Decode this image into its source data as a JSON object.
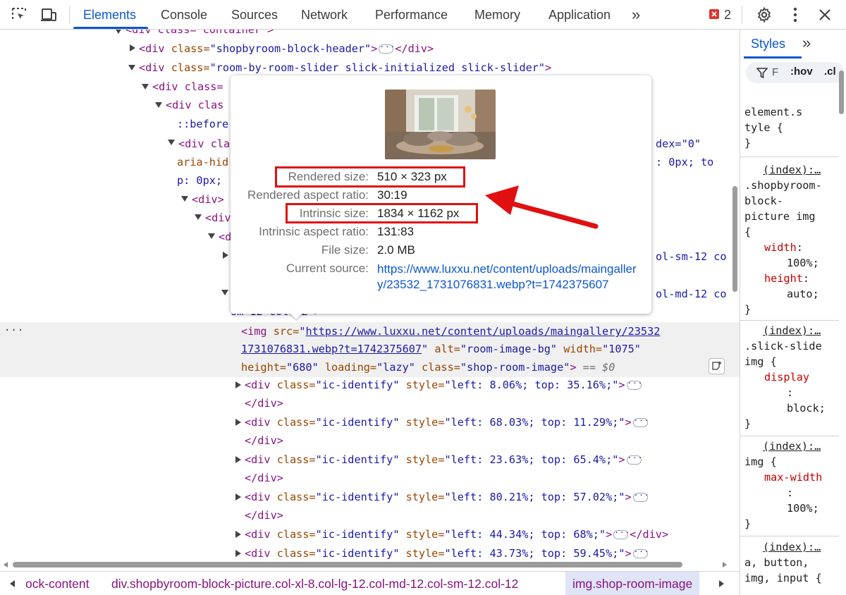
{
  "toolbar": {
    "tabs": [
      "Elements",
      "Console",
      "Sources",
      "Network",
      "Performance",
      "Memory",
      "Application"
    ],
    "active_tab": "Elements",
    "more_tabs": "»",
    "error_count": "2",
    "icons": [
      "inspect-element-icon",
      "device-toolbar-icon",
      "more-tabs-icon",
      "error-icon",
      "settings-gear-icon",
      "kebab-menu-icon",
      "close-icon"
    ]
  },
  "dom": {
    "line0": "<div class=\"container\">",
    "l1_tag_open": "<div ",
    "l1_attr": "class=",
    "l1_val": "\"shopbyroom-block-header\"",
    "l1_close": ">",
    "l1_end": "</div>",
    "l2_tag_open": "<div ",
    "l2_attr": "class=",
    "l2_val": "\"room-by-room-slider slick-initialized slick-slider\"",
    "l2_close": ">",
    "l3": "<div class=",
    "l4": "<div clas",
    "l5": "::before",
    "l6": "<div cla",
    "l6_right": "dex=\"0\"",
    "l7": "aria-hid",
    "l7_right": ": 0px; to",
    "l8": "p: 0px;",
    "l9": "<div>",
    "l10": "<div",
    "l11": "<d",
    "l12_right": "ol-sm-12 co",
    "l13_right": "ol-md-12 co",
    "l14": "sm-12 col-12\">",
    "img_open": "<img ",
    "img_src_attr": "src=",
    "img_src_q1": "\"",
    "img_src_url1": "https://www.luxxu.net/content/uploads/maingallery/23532",
    "img_src_url2": "1731076831.webp?t=1742375607",
    "img_src_q2": "\"",
    "img_alt_attr": " alt=",
    "img_alt_val": "\"room-image-bg\"",
    "img_width_attr": " width=",
    "img_width_val": "\"1075\"",
    "img_height_attr": "height=",
    "img_height_val": "\"680\"",
    "img_loading_attr": " loading=",
    "img_loading_val": "\"lazy\"",
    "img_class_attr": " class=",
    "img_class_val": "\"shop-room-image\"",
    "img_close": ">",
    "img_eq": " == $0",
    "row_menu": "...",
    "ic_rows": [
      {
        "style": "\"left: 8.06%; top: 35.16%;\""
      },
      {
        "style": "\"left: 68.03%; top: 11.29%;\""
      },
      {
        "style": "\"left: 23.63%; top: 65.4%;\""
      },
      {
        "style": "\"left: 80.21%; top: 57.02%;\""
      },
      {
        "style": "\"left: 44.34%; top: 68%;\""
      },
      {
        "style": "\"left: 43.73%; top: 59.45%;\""
      }
    ],
    "ic_tag": "<div ",
    "ic_attr1": "class=",
    "ic_val1": "\"ic-identify\"",
    "ic_attr2": " style=",
    "ic_close": ">",
    "ic_end": "</div>"
  },
  "breadcrumb": {
    "items": [
      "ock-content",
      "div.shopbyroom-block-picture.col-xl-8.col-lg-12.col-md-12.col-sm-12.col-12",
      "img.shop-room-image"
    ]
  },
  "styles": {
    "tab": "Styles",
    "more": "»",
    "filter": "F",
    "hov": ":hov",
    "cls": ".cl",
    "rules": {
      "r0": [
        "element.s",
        "tyle {",
        "}"
      ],
      "r1_src": "(index):…",
      "r1_sel": [
        ".shopbyroom-",
        "block-",
        "picture img",
        "{"
      ],
      "r1_p1": "width",
      "r1_v1": "100%;",
      "r1_p2": "height",
      "r1_v2": "auto;",
      "r2_src": "(index):…",
      "r2_sel": [
        ".slick-slide",
        "img {"
      ],
      "r2_p1": "display",
      "r2_v1": "block;",
      "r3_src": "(index):…",
      "r3_sel": [
        "img {"
      ],
      "r3_p1": "max-width",
      "r3_v1": "100%;",
      "r4_src": "(index):…",
      "r4_sel": [
        "a, button,",
        "img, input {"
      ],
      "close": "}",
      "colon": ":"
    }
  },
  "popover": {
    "rows": [
      {
        "label": "Rendered size:",
        "value": "510 × 323 px"
      },
      {
        "label": "Rendered aspect ratio:",
        "value": "30:19"
      },
      {
        "label": "Intrinsic size:",
        "value": "1834 × 1162 px"
      },
      {
        "label": "Intrinsic aspect ratio:",
        "value": "131:83"
      },
      {
        "label": "File size:",
        "value": "2.0 MB"
      },
      {
        "label": "Current source:",
        "value": "https://www.luxxu.net/content/uploads/maingallery/23532_1731076831.webp?t=1742375607"
      }
    ],
    "highlighted_rows": [
      "Rendered size:",
      "Intrinsic size:"
    ]
  },
  "colors": {
    "accent": "#0b57d0",
    "highlight_box": "#e01010",
    "arrow": "#e01010",
    "tag": "#881280",
    "attr_name": "#994500",
    "attr_value": "#1a1aa6"
  }
}
